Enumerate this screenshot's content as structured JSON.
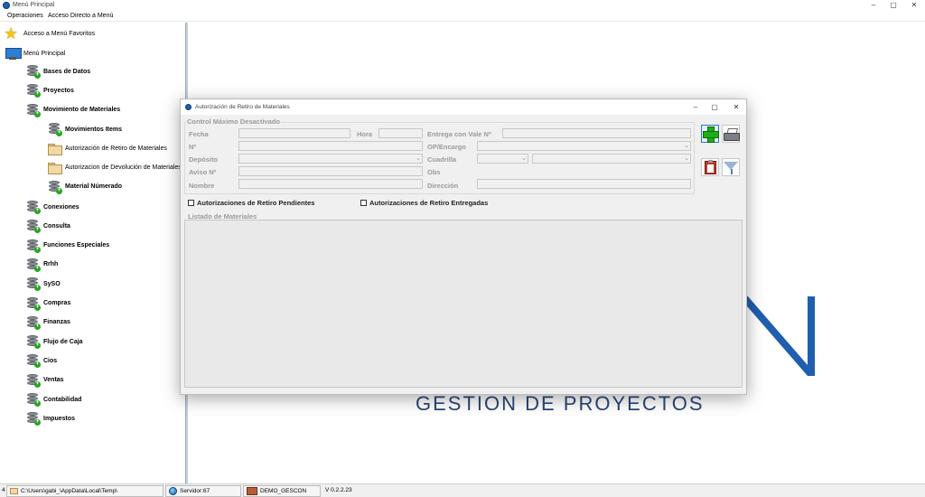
{
  "window": {
    "title": "Menú Principal",
    "controls": {
      "minimize": "–",
      "maximize": "▢",
      "close": "✕"
    }
  },
  "menubar": {
    "items": [
      "Operaciones",
      "Acceso Directo a Menú"
    ]
  },
  "tree": {
    "favorites": "Acceso a Menú Favoritos",
    "root": "Menú Principal",
    "modules": [
      "Bases de Datos",
      "Proyectos",
      "Movimiento de Materiales"
    ],
    "submodules": [
      {
        "label": "Movimientos Items",
        "icon": "database-icon"
      },
      {
        "label": "Autorización de Retiro de Materiales",
        "icon": "folder-icon"
      },
      {
        "label": "Autorizacion de Devolución de Materiales",
        "icon": "folder-icon"
      },
      {
        "label": "Material Númerado",
        "icon": "database-icon"
      }
    ],
    "modules_after": [
      "Conexiones",
      "Consulta",
      "Funciones Especiales",
      "Rrhh",
      "SySO",
      "Compras",
      "Finanzas",
      "Flujo de Caja",
      "Cios",
      "Ventas",
      "Contabilidad",
      "Impuestos"
    ]
  },
  "background_logo": {
    "letter": "N",
    "text": "GESTIÓN DE PROYECTOS",
    "color": "#1f5fad"
  },
  "dialog": {
    "title": "Autorización de Retiro de Materiales",
    "controls": {
      "minimize": "–",
      "maximize": "▢",
      "close": "✕"
    },
    "group_title": "Control Máximo Desactivado",
    "fields": {
      "fecha": "Fecha",
      "hora": "Hora",
      "entrega": "Entrega con Vale Nº",
      "numero": "Nº",
      "op": "OP/Encargo",
      "deposito": "Depósito",
      "cuadrilla": "Cuadrilla",
      "aviso": "Aviso Nº",
      "obs": "Obs",
      "nombre": "Nombre",
      "direccion": "Dirección"
    },
    "checkboxes": {
      "pendientes": "Autorizaciones de Retiro Pendientes",
      "entregadas": "Autorizaciones de Retiro Entregadas"
    },
    "list_title": "Listado de Materiales"
  },
  "statusbar": {
    "path": "C:\\Users\\gabi_\\AppData\\Local\\Temp\\",
    "server": "Servidor:67",
    "database": "DEMO_GESCON",
    "version": "V 0.2.2.23",
    "left_marker": "4"
  },
  "colors": {
    "accent": "#2a78c7",
    "add_green": "#1fae1a",
    "logo_blue": "#1f5fad"
  }
}
